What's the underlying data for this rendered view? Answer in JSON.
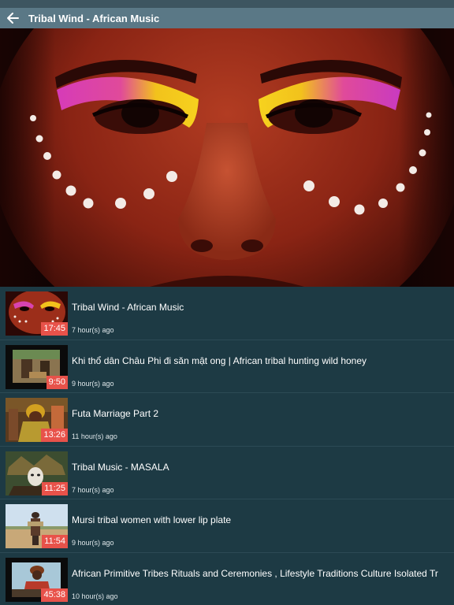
{
  "header": {
    "title": "Tribal Wind - African Music",
    "back_icon": "arrow-left-icon"
  },
  "player": {
    "current_video_title": "Tribal Wind - African Music"
  },
  "colors": {
    "header_bg": "#5a7886",
    "list_bg": "#1d3a44",
    "duration_badge": "#e8524a"
  },
  "videos": [
    {
      "title": "Tribal Wind - African Music",
      "duration": "17:45",
      "age": "7 hour(s) ago"
    },
    {
      "title": "Khi thổ dân Châu Phi đi săn mật ong | African tribal hunting wild honey",
      "duration": "9:50",
      "age": "9 hour(s) ago"
    },
    {
      "title": "Futa Marriage Part 2",
      "duration": "13:26",
      "age": "11 hour(s) ago"
    },
    {
      "title": "Tribal Music - MASALA",
      "duration": "11:25",
      "age": "7 hour(s) ago"
    },
    {
      "title": "Mursi tribal women with lower lip plate",
      "duration": "11:54",
      "age": "9 hour(s) ago"
    },
    {
      "title": "African Primitive Tribes Rituals and Ceremonies , Lifestyle Traditions Culture Isolated Tr",
      "duration": "45:38",
      "age": "10 hour(s) ago"
    }
  ]
}
